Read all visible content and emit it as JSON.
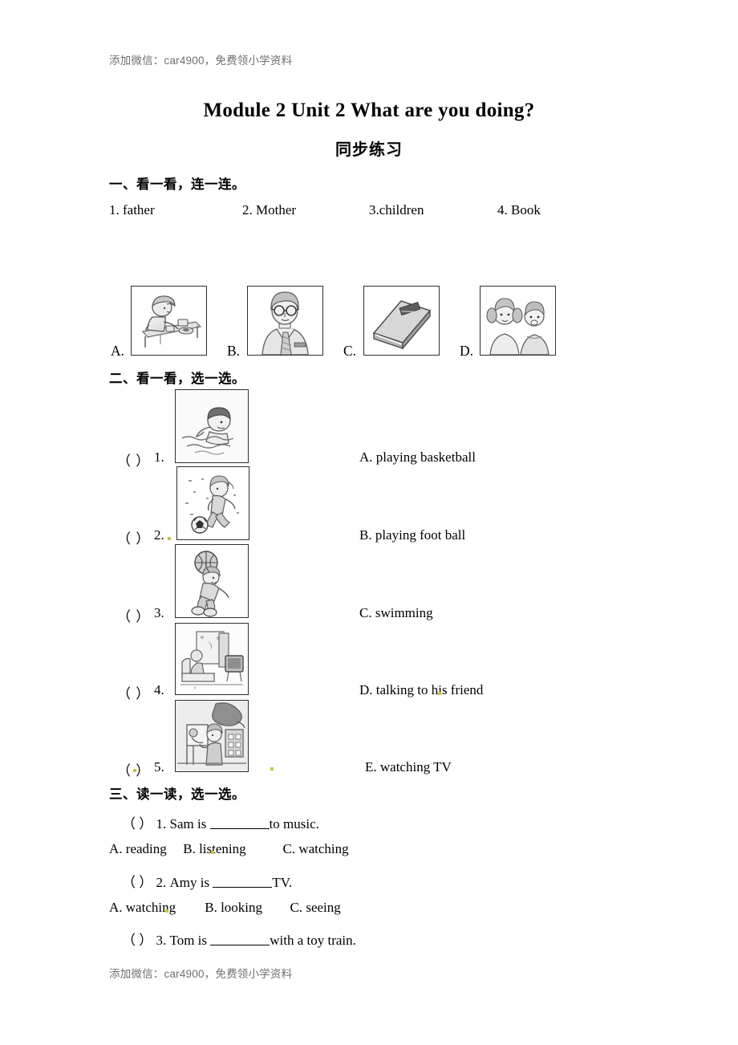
{
  "watermark": {
    "top": "添加微信：car4900，免费领小学资料",
    "bottom": "添加微信：car4900，免费领小学资料"
  },
  "document": {
    "title": "Module 2 Unit 2 What are you doing?",
    "subtitle": "同步练习"
  },
  "section1": {
    "heading": "一、看一看，连一连。",
    "words": [
      "1. father",
      "2. Mother",
      "3.children",
      "4. Book"
    ],
    "pictures": [
      {
        "label": "A.",
        "alt": "mother-cooking-picture"
      },
      {
        "label": "B.",
        "alt": "father-with-glasses-picture"
      },
      {
        "label": "C.",
        "alt": "book-picture"
      },
      {
        "label": "D.",
        "alt": "two-children-picture"
      }
    ]
  },
  "section2": {
    "heading": "二、看一看，选一选。",
    "items": [
      {
        "bracket": "（    ）",
        "number": "1.",
        "alt": "swimming-picture"
      },
      {
        "bracket": "（    ）",
        "number": "2.",
        "alt": "playing-football-picture"
      },
      {
        "bracket": "（    ）",
        "number": "3.",
        "alt": "playing-basketball-picture"
      },
      {
        "bracket": "（    ）",
        "number": "4.",
        "alt": "watching-tv-picture"
      },
      {
        "bracket": "（    ）",
        "number": "5.",
        "alt": "talking-on-phone-picture"
      }
    ],
    "options": [
      "A. playing basketball",
      "B. playing foot ball",
      "C. swimming",
      "D. talking to  his friend",
      "E. watching TV"
    ]
  },
  "section3": {
    "heading": "三、读一读，选一选。",
    "questions": [
      {
        "bracket": "（    ）",
        "number": "1.",
        "stem_before": "Sam is ",
        "stem_after": "to music.",
        "options": [
          "A. reading",
          "B.  listening",
          "C. watching"
        ]
      },
      {
        "bracket": "（    ）",
        "number": "2.",
        "stem_before": "Amy is ",
        "stem_after": "TV.",
        "options": [
          "A. watching",
          "B. looking",
          "C. seeing"
        ]
      },
      {
        "bracket": "（    ）",
        "number": "3.",
        "stem_before": "Tom is ",
        "stem_after": "with a toy train.",
        "options": []
      }
    ]
  },
  "colors": {
    "text": "#000000",
    "watermark": "#6f6f6f",
    "frame": "#2f2f2f",
    "highlight": "#c9c43f"
  }
}
